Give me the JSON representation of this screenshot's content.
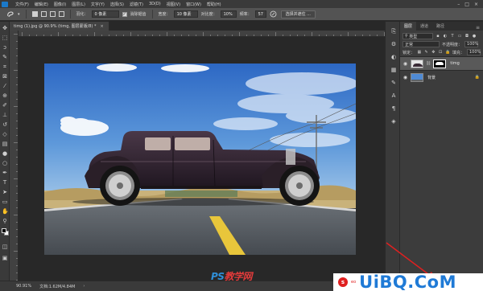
{
  "menubar": {
    "items": [
      "文件(F)",
      "编辑(E)",
      "图像(I)",
      "图层(L)",
      "文字(Y)",
      "选择(S)",
      "滤镜(T)",
      "3D(D)",
      "视图(V)",
      "窗口(W)",
      "帮助(H)"
    ]
  },
  "options": {
    "feather_label": "羽化：",
    "feather_value": "0 像素",
    "antialias_label": "消除锯齿",
    "width_label": "宽度：",
    "width_value": "10 像素",
    "contrast_label": "对比度：",
    "contrast_value": "10%",
    "frequency_label": "频率：",
    "frequency_value": "57",
    "select_mask_button": "选择并遮住 ..."
  },
  "document_tab": {
    "title": "timg (1).jpg @ 90.9% (timg, 图层蒙版/8) *",
    "close_glyph": "×"
  },
  "layers_panel": {
    "tabs": [
      "图层",
      "通道",
      "路径"
    ],
    "filter_kind": "类型",
    "blend_mode": "正常",
    "opacity_label": "不透明度：",
    "opacity_value": "100%",
    "lock_label": "锁定：",
    "fill_label": "填充：",
    "fill_value": "100%",
    "layers": [
      {
        "name": "timg",
        "selected": true,
        "has_mask": true
      },
      {
        "name": "背景",
        "selected": false,
        "has_mask": false
      }
    ]
  },
  "statusbar": {
    "zoom": "90.91%",
    "doc_info": "文档:1.62M/4.84M"
  },
  "watermark": {
    "ps_prefix": "PS",
    "ps_suffix": "教学网",
    "logo_badge": "s",
    "logo_sub": "eo",
    "logo_brand": "UiBQ.CoM"
  },
  "colors": {
    "ps_blue": "#1b79c9",
    "foreground": "#000000",
    "background": "#ffffff",
    "accent_red": "#e02020"
  }
}
